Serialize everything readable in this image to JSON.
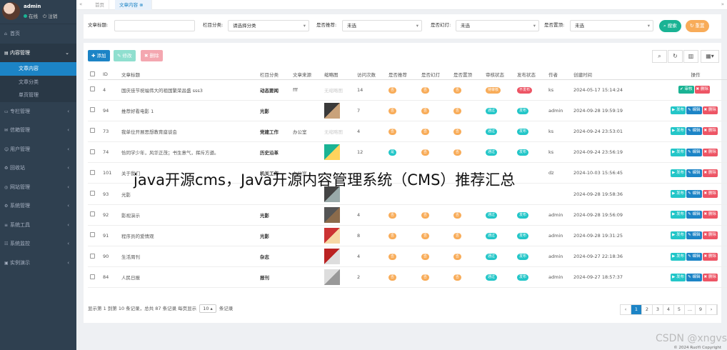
{
  "user": {
    "name": "admin",
    "online": "在线",
    "logout": "注销"
  },
  "nav": [
    {
      "icon": "home-icon",
      "glyph": "⌂",
      "label": "首页"
    },
    {
      "icon": "content-icon",
      "glyph": "▤",
      "label": "内容管理",
      "open": true,
      "subs": [
        {
          "label": "文章内容",
          "active": true
        },
        {
          "label": "文章分类"
        },
        {
          "label": "单页管理"
        }
      ]
    },
    {
      "icon": "column-icon",
      "glyph": "▭",
      "label": "专栏管理"
    },
    {
      "icon": "message-icon",
      "glyph": "✉",
      "label": "信箱管理"
    },
    {
      "icon": "user-icon",
      "glyph": "☺",
      "label": "用户管理"
    },
    {
      "icon": "recycle-icon",
      "glyph": "♻",
      "label": "回收站"
    },
    {
      "icon": "globe-icon",
      "glyph": "◎",
      "label": "网站管理"
    },
    {
      "icon": "gear-icon",
      "glyph": "⚙",
      "label": "系统管理"
    },
    {
      "icon": "tool-icon",
      "glyph": "≡",
      "label": "系统工具"
    },
    {
      "icon": "monitor-icon",
      "glyph": "☷",
      "label": "系统监控"
    },
    {
      "icon": "demo-icon",
      "glyph": "▣",
      "label": "实例演示"
    }
  ],
  "tabs": {
    "home": "首页",
    "current": "文章内容"
  },
  "search": {
    "title_label": "文章标题:",
    "column_label": "栏目分类:",
    "column_value": "请选择分类",
    "recommend_label": "是否推荐:",
    "recommend_value": "未选",
    "slide_label": "是否幻灯:",
    "slide_value": "未选",
    "top_label": "是否置顶:",
    "top_value": "未选",
    "search_btn": "搜索",
    "reset_btn": "重置"
  },
  "actions": {
    "add": "添加",
    "edit": "修改",
    "delete": "删除"
  },
  "columns": [
    "ID",
    "文章标题",
    "栏目分类",
    "文章来源",
    "缩略图",
    "访问次数",
    "是否推荐",
    "是否幻灯",
    "是否置顶",
    "审核状态",
    "发布状态",
    "作者",
    "创建时间",
    "操作"
  ],
  "rows": [
    {
      "id": "4",
      "title": "国庆佳节祝福伟大的祖国繁荣昌盛 sss3",
      "cat": "动态要闻",
      "src": "fff",
      "thumb": "无缩略图",
      "views": "14",
      "rec": "否",
      "slide": "否",
      "top": "否",
      "audit": "待审核",
      "pub": "不发布",
      "author": "ks",
      "time": "2024-05-17 15:14:24",
      "ops": [
        "审核",
        "删除"
      ]
    },
    {
      "id": "94",
      "title": "推荐好看电影 1",
      "cat": "光影",
      "src": "",
      "thumb": "",
      "views": "7",
      "rec": "否",
      "slide": "否",
      "top": "否",
      "audit": "通过",
      "pub": "发布",
      "author": "admin",
      "time": "2024-09-28 19:59:19",
      "ops": [
        "发布",
        "编辑",
        "删除"
      ]
    },
    {
      "id": "73",
      "title": "我单位开展思想教育座谈会",
      "cat": "党建工作",
      "src": "办公室",
      "thumb": "无缩略图",
      "views": "4",
      "rec": "否",
      "slide": "否",
      "top": "否",
      "audit": "通过",
      "pub": "发布",
      "author": "ks",
      "time": "2024-09-24 23:53:01",
      "ops": [
        "发布",
        "编辑",
        "删除"
      ]
    },
    {
      "id": "74",
      "title": "恰同学少年，风华正茂；书生意气，挥斥方遒。",
      "cat": "历史沿革",
      "src": "",
      "thumb": "",
      "views": "12",
      "rec": "是",
      "slide": "否",
      "top": "否",
      "audit": "通过",
      "pub": "发布",
      "author": "ks",
      "time": "2024-09-24 23:56:19",
      "ops": [
        "发布",
        "编辑",
        "删除"
      ]
    },
    {
      "id": "101",
      "title": "关于我们",
      "cat": "机关工作",
      "src": "办公室",
      "thumb": "",
      "views": "",
      "rec": "",
      "slide": "",
      "top": "",
      "audit": "",
      "pub": "",
      "author": "dz",
      "time": "2024-10-03 15:56:45",
      "ops": [
        "发布",
        "编辑",
        "删除"
      ]
    },
    {
      "id": "93",
      "title": "光影",
      "cat": "",
      "src": "",
      "thumb": "",
      "views": "",
      "rec": "",
      "slide": "",
      "top": "",
      "audit": "",
      "pub": "",
      "author": "",
      "time": "2024-09-28 19:58:36",
      "ops": [
        "发布",
        "编辑",
        "删除"
      ]
    },
    {
      "id": "92",
      "title": "影视演示",
      "cat": "光影",
      "src": "",
      "thumb": "",
      "views": "4",
      "rec": "否",
      "slide": "否",
      "top": "否",
      "audit": "通过",
      "pub": "发布",
      "author": "admin",
      "time": "2024-09-28 19:56:09",
      "ops": [
        "发布",
        "编辑",
        "删除"
      ]
    },
    {
      "id": "91",
      "title": "程序员的爱情观",
      "cat": "光影",
      "src": "",
      "thumb": "",
      "views": "8",
      "rec": "否",
      "slide": "否",
      "top": "否",
      "audit": "通过",
      "pub": "发布",
      "author": "admin",
      "time": "2024-09-28 19:31:25",
      "ops": [
        "发布",
        "编辑",
        "删除"
      ]
    },
    {
      "id": "90",
      "title": "生活周刊",
      "cat": "杂志",
      "src": "",
      "thumb": "",
      "views": "4",
      "rec": "否",
      "slide": "否",
      "top": "否",
      "audit": "通过",
      "pub": "发布",
      "author": "admin",
      "time": "2024-09-27 22:18:36",
      "ops": [
        "发布",
        "编辑",
        "删除"
      ]
    },
    {
      "id": "84",
      "title": "人民日报",
      "cat": "报刊",
      "src": "",
      "thumb": "",
      "views": "2",
      "rec": "否",
      "slide": "否",
      "top": "否",
      "audit": "通过",
      "pub": "发布",
      "author": "admin",
      "time": "2024-09-27 18:57:37",
      "ops": [
        "发布",
        "编辑",
        "删除"
      ]
    }
  ],
  "footer": {
    "info": "显示第 1 到第 10 条记录，总共 87 条记录  每页显示",
    "page_size": "10 ▴",
    "suffix": "条记录",
    "pages": [
      "‹",
      "1",
      "2",
      "3",
      "4",
      "5",
      "...",
      "9",
      "›"
    ]
  },
  "overlay": "java开源cms，Java开源内容管理系统（CMS）推荐汇总",
  "watermark": "CSDN @xngvs",
  "copyright": "© 2024 RuoYi Copyright"
}
